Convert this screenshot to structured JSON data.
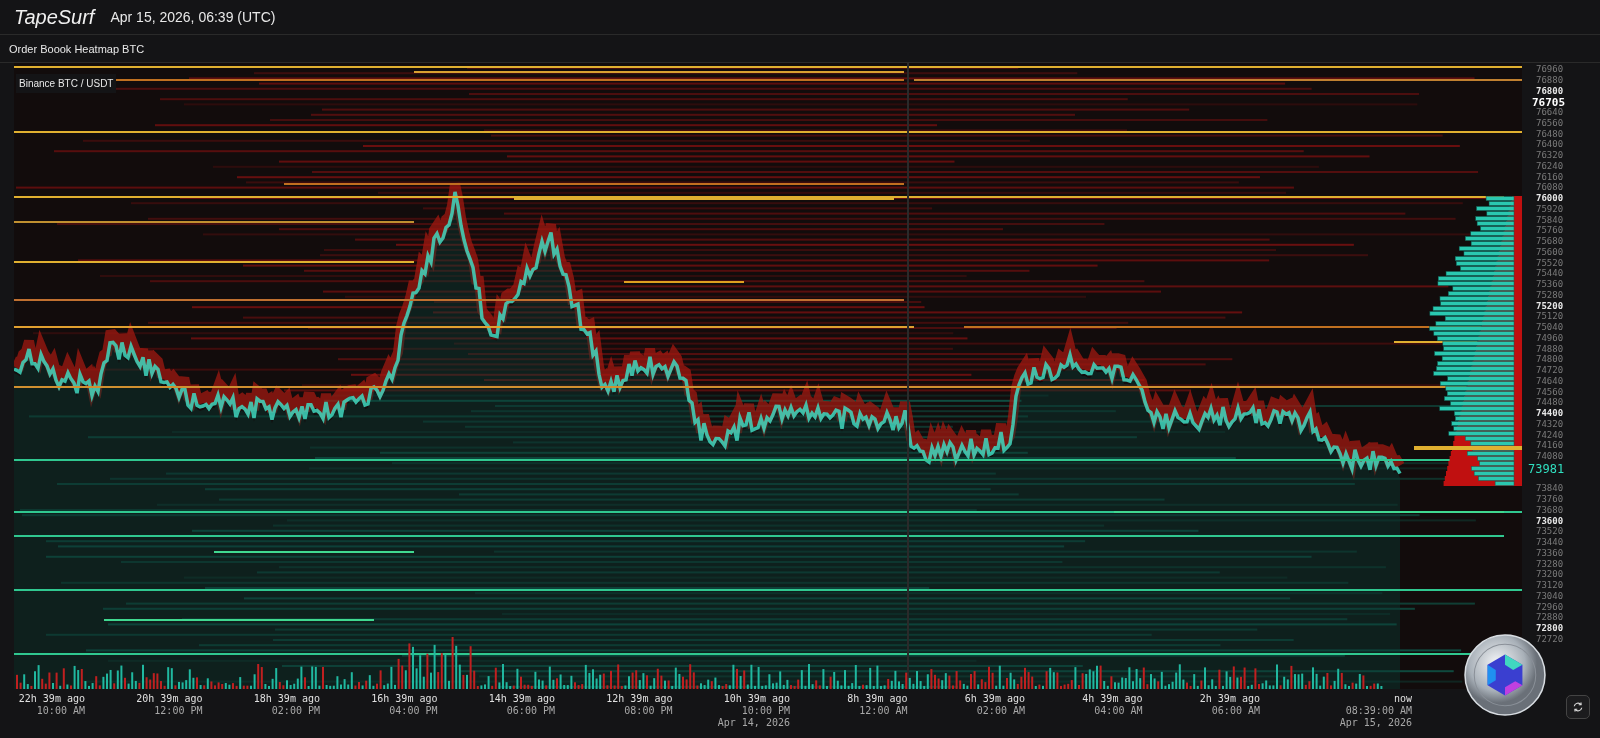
{
  "header": {
    "logo": "TapeSurf",
    "datetime": "Apr 15, 2026, 06:39 (UTC)"
  },
  "panel": {
    "title": "Order Boook Heatmap BTC",
    "market": "Binance BTC / USDT"
  },
  "price_axis": {
    "current_price": "73981",
    "labels": [
      {
        "text": "76960",
        "kind": "minor"
      },
      {
        "text": "76880",
        "kind": "minor"
      },
      {
        "text": "76800",
        "kind": "major"
      },
      {
        "text": "76705",
        "kind": "last"
      },
      {
        "text": "76640",
        "kind": "minor"
      },
      {
        "text": "76560",
        "kind": "minor"
      },
      {
        "text": "76480",
        "kind": "minor"
      },
      {
        "text": "76400",
        "kind": "minor"
      },
      {
        "text": "76320",
        "kind": "minor"
      },
      {
        "text": "76240",
        "kind": "minor"
      },
      {
        "text": "76160",
        "kind": "minor"
      },
      {
        "text": "76080",
        "kind": "minor"
      },
      {
        "text": "76000",
        "kind": "major"
      },
      {
        "text": "75920",
        "kind": "minor"
      },
      {
        "text": "75840",
        "kind": "minor"
      },
      {
        "text": "75760",
        "kind": "minor"
      },
      {
        "text": "75680",
        "kind": "minor"
      },
      {
        "text": "75600",
        "kind": "minor"
      },
      {
        "text": "75520",
        "kind": "minor"
      },
      {
        "text": "75440",
        "kind": "minor"
      },
      {
        "text": "75360",
        "kind": "minor"
      },
      {
        "text": "75280",
        "kind": "minor"
      },
      {
        "text": "75200",
        "kind": "major"
      },
      {
        "text": "75120",
        "kind": "minor"
      },
      {
        "text": "75040",
        "kind": "minor"
      },
      {
        "text": "74960",
        "kind": "minor"
      },
      {
        "text": "74880",
        "kind": "minor"
      },
      {
        "text": "74800",
        "kind": "minor"
      },
      {
        "text": "74720",
        "kind": "minor"
      },
      {
        "text": "74640",
        "kind": "minor"
      },
      {
        "text": "74560",
        "kind": "minor"
      },
      {
        "text": "74480",
        "kind": "minor"
      },
      {
        "text": "74400",
        "kind": "major"
      },
      {
        "text": "74320",
        "kind": "minor"
      },
      {
        "text": "74240",
        "kind": "minor"
      },
      {
        "text": "74160",
        "kind": "minor"
      },
      {
        "text": "74080",
        "kind": "minor"
      },
      {
        "text": "73840",
        "kind": "minor"
      },
      {
        "text": "73760",
        "kind": "minor"
      },
      {
        "text": "73680",
        "kind": "minor"
      },
      {
        "text": "73600",
        "kind": "major"
      },
      {
        "text": "73520",
        "kind": "minor"
      },
      {
        "text": "73440",
        "kind": "minor"
      },
      {
        "text": "73360",
        "kind": "minor"
      },
      {
        "text": "73280",
        "kind": "minor"
      },
      {
        "text": "73200",
        "kind": "minor"
      },
      {
        "text": "73120",
        "kind": "minor"
      },
      {
        "text": "73040",
        "kind": "minor"
      },
      {
        "text": "72960",
        "kind": "minor"
      },
      {
        "text": "72880",
        "kind": "minor"
      },
      {
        "text": "72800",
        "kind": "major"
      },
      {
        "text": "72720",
        "kind": "minor"
      }
    ]
  },
  "time_axis": [
    {
      "ago": "22h 39m ago",
      "time": "10:00 AM"
    },
    {
      "ago": "20h 39m ago",
      "time": "12:00 PM"
    },
    {
      "ago": "18h 39m ago",
      "time": "02:00 PM"
    },
    {
      "ago": "16h 39m ago",
      "time": "04:00 PM"
    },
    {
      "ago": "14h 39m ago",
      "time": "06:00 PM"
    },
    {
      "ago": "12h 39m ago",
      "time": "08:00 PM"
    },
    {
      "ago": "10h 39m ago",
      "time": "10:00 PM",
      "date": "Apr 14, 2026"
    },
    {
      "ago": "8h 39m ago",
      "time": "12:00 AM"
    },
    {
      "ago": "6h 39m ago",
      "time": "02:00 AM"
    },
    {
      "ago": "4h 39m ago",
      "time": "04:00 AM"
    },
    {
      "ago": "2h 39m ago",
      "time": "06:00 AM"
    },
    {
      "ago": "now",
      "time": "08:39:00 AM",
      "date": "Apr 15, 2026"
    }
  ]
}
